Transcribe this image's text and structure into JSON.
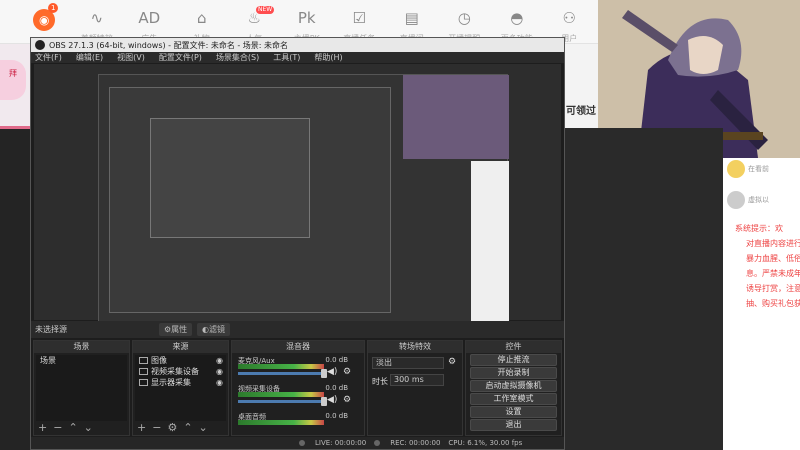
{
  "topbar": {
    "items": [
      {
        "icon": "home-icon",
        "glyph": "◉",
        "label": "",
        "badge": "1"
      },
      {
        "icon": "waveform-icon",
        "glyph": "∿",
        "label": "美颜特效"
      },
      {
        "icon": "ad-icon",
        "glyph": "AD",
        "label": "广告"
      },
      {
        "icon": "gift-icon",
        "glyph": "⌂",
        "label": "礼物"
      },
      {
        "icon": "flame-icon",
        "glyph": "♨",
        "label": "人气",
        "badge": "NEW"
      },
      {
        "icon": "pk-icon",
        "glyph": "Pk",
        "label": "主播PK"
      },
      {
        "icon": "checklist-icon",
        "glyph": "☑",
        "label": "直播任务"
      },
      {
        "icon": "clipboard-icon",
        "glyph": "▤",
        "label": "直播间"
      },
      {
        "icon": "clock-icon",
        "glyph": "◷",
        "label": "开播提醒"
      },
      {
        "icon": "ufo-icon",
        "glyph": "◓",
        "label": "更多功能"
      },
      {
        "icon": "users-icon",
        "glyph": "⚇",
        "label": "用户"
      }
    ]
  },
  "behind": {
    "right_text": "可领过",
    "left_avatar": "拜"
  },
  "chat": {
    "rows": [
      {
        "text": "在看前",
        "top": "162"
      },
      {
        "text": "虚拟以",
        "top": "193"
      }
    ],
    "system_title": "系统提示：欢",
    "system_lines": [
      "对直播内容进行",
      "暴力血腥、低俗",
      "息。严禁未成年",
      "诱导打赏，注意",
      "抽、购买礼包获"
    ]
  },
  "obs": {
    "title": "OBS 27.1.3 (64-bit, windows) - 配置文件: 未命名 - 场景: 未命名",
    "menu": [
      "文件(F)",
      "编辑(E)",
      "视图(V)",
      "配置文件(P)",
      "场景集合(S)",
      "工具(T)",
      "帮助(H)"
    ],
    "transition_bar": {
      "label": "未选择源",
      "props_btn": "属性",
      "filter_btn": "滤镜"
    },
    "docks": {
      "scenes": {
        "title": "场景",
        "items": [
          "场景"
        ]
      },
      "sources": {
        "title": "来源",
        "items": [
          "图像",
          "视频采集设备",
          "显示器采集"
        ]
      },
      "mixer": {
        "title": "混音器",
        "channels": [
          {
            "name": "麦克风/Aux",
            "db": "0.0 dB"
          },
          {
            "name": "视频采集设备",
            "db": "0.0 dB"
          },
          {
            "name": "桌面音频",
            "db": "0.0 dB"
          }
        ]
      },
      "transitions": {
        "title": "转场特效",
        "type": "淡出",
        "duration_label": "时长",
        "duration": "300 ms"
      },
      "controls": {
        "title": "控件",
        "buttons": [
          "停止推流",
          "开始录制",
          "启动虚拟摄像机",
          "工作室模式",
          "设置",
          "退出"
        ]
      }
    },
    "status": {
      "live": "LIVE: 00:00:00",
      "rec": "REC: 00:00:00",
      "cpu": "CPU: 6.1%, 30.00 fps"
    }
  },
  "colors": {
    "accent": "#4c7bb0",
    "notify": "#ff5a2a",
    "system": "#e44444"
  }
}
